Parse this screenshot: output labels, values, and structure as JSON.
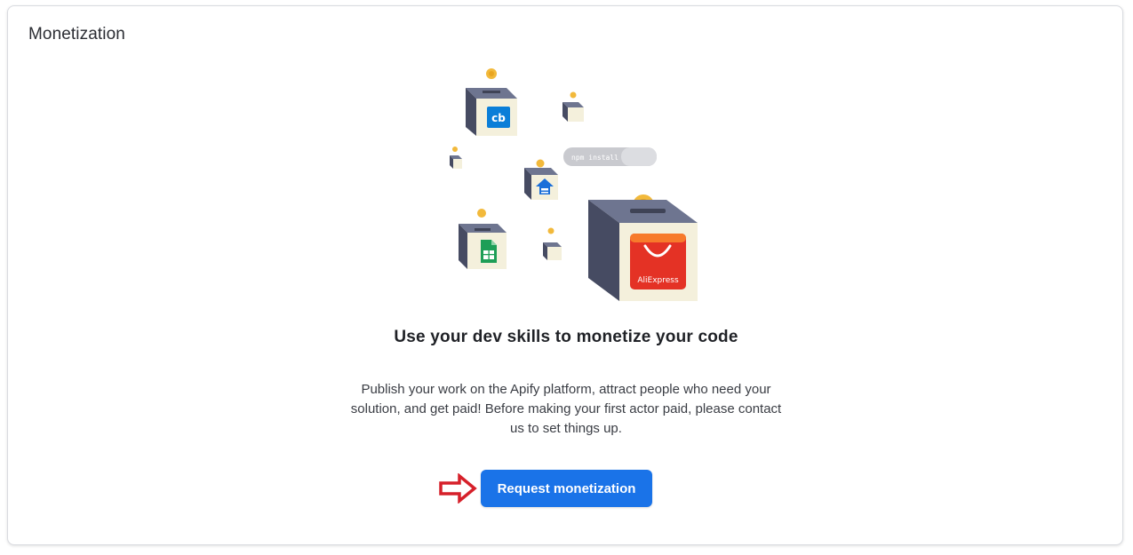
{
  "card": {
    "title": "Monetization"
  },
  "illustration": {
    "terminal_text": "npm install",
    "box_labels": {
      "cb": "cb",
      "aliexpress": "AliExpress"
    },
    "icons": [
      "coin-icon",
      "cb-logo-icon",
      "zillow-logo-icon",
      "google-sheets-icon",
      "aliexpress-logo-icon",
      "terminal-icon"
    ]
  },
  "main": {
    "headline": "Use your dev skills to monetize your code",
    "description": "Publish your work on the Apify platform, attract people who need your solution, and get paid! Before making your first actor paid, please contact us to set things up.",
    "cta_label": "Request monetization"
  },
  "colors": {
    "accent": "#1a73e8",
    "arrow": "#d6202a",
    "coin": "#f2b93b",
    "aliexpress": "#e43225"
  }
}
